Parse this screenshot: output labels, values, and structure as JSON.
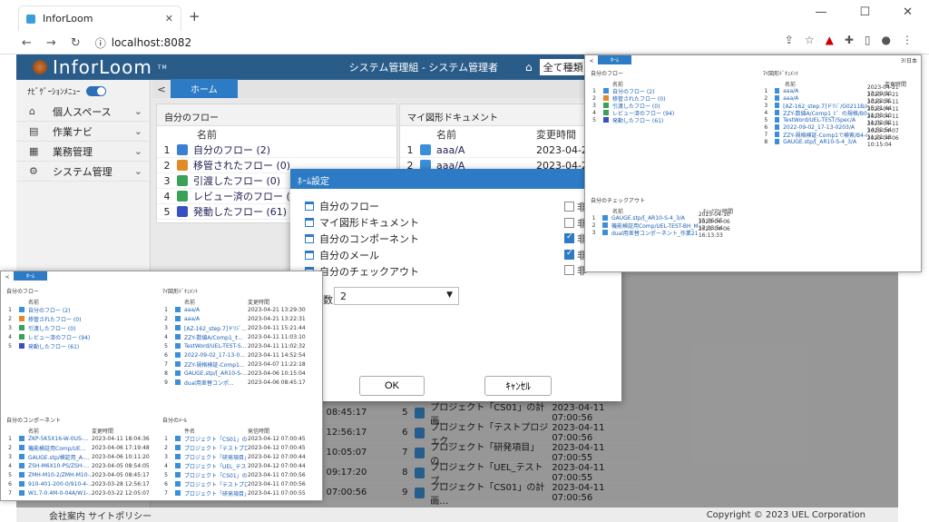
{
  "browser": {
    "tab_title": "InforLoom",
    "url": "localhost:8082",
    "new_tab": "+",
    "minimize": "—",
    "maximize": "☐",
    "close": "✕"
  },
  "app": {
    "logo": "InforLoom",
    "logo_tm": "TM",
    "company": "システム管理組 - システム管理者",
    "scope_select": "全て種類",
    "nav_menu_label": "ﾅﾋﾞｹﾞｰｼｮﾝﾒﾆｭｰ",
    "nav": [
      {
        "label": "個人スペース",
        "icon": "home-icon"
      },
      {
        "label": "作業ナビ",
        "icon": "document-icon"
      },
      {
        "label": "業務管理",
        "icon": "grid-icon"
      },
      {
        "label": "システム管理",
        "icon": "gear-icon"
      }
    ],
    "home_tab": "ホーム",
    "back": "<",
    "footer_left": "会社案内 サイトポリシー",
    "footer_right": "Copyright © 2023 UEL Corporation"
  },
  "my_flow": {
    "title": "自分のフロー",
    "col_name": "名前",
    "rows": [
      {
        "n": "1",
        "label": "自分のフロー (2)",
        "color": "#3a7fd0"
      },
      {
        "n": "2",
        "label": "移管されたフロー (0)",
        "color": "#e08a2a"
      },
      {
        "n": "3",
        "label": "引渡したフロー (0)",
        "color": "#3aa05a"
      },
      {
        "n": "4",
        "label": "レビュー済のフロー (94)",
        "color": "#3aa05a"
      },
      {
        "n": "5",
        "label": "発動したフロー (61)",
        "color": "#3a4fc0"
      }
    ]
  },
  "my_docs": {
    "title": "マイ図形ドキュメント",
    "col_name": "名前",
    "col_time": "変更時間",
    "rows": [
      {
        "n": "1",
        "label": "aaa/A",
        "time": "2023-04-2"
      },
      {
        "n": "2",
        "label": "aaa/A",
        "time": "2023-04-2"
      }
    ]
  },
  "bottom_rows": [
    {
      "n": "5",
      "left_time": "-05 08:45:17",
      "label": "プロジェクト「CS01」の計画…",
      "time": "2023-04-11 07:00:56"
    },
    {
      "n": "6",
      "left_time": "-28 12:56:17",
      "label": "プロジェクト「テストプロジェク…",
      "time": "2023-04-11 07:00:56"
    },
    {
      "n": "7",
      "left_time": "-22 10:05:07",
      "label": "プロジェクト「研発項目」の…",
      "time": "2023-04-11 07:00:55"
    },
    {
      "n": "8",
      "left_time": "-22 09:17:20",
      "label": "プロジェクト「UEL_テストプ…",
      "time": "2023-04-11 07:00:55"
    },
    {
      "n": "9",
      "left_time": "-22 07:00:56",
      "label": "プロジェクト「CS01」の計画…",
      "time": "2023-04-11 07:00:56"
    }
  ],
  "dialog": {
    "title": "ﾎｰﾑ設定",
    "options": [
      "自分のフロー",
      "マイ図形ドキュメント",
      "自分のコンポーネント",
      "自分のメール",
      "自分のチェックアウト"
    ],
    "checkbox_labels": [
      "非",
      "非",
      "非",
      "非",
      "非"
    ],
    "checked": [
      false,
      false,
      true,
      true,
      false
    ],
    "count_label": "数",
    "count_value": "2",
    "ok": "OK",
    "cancel": "ｷｬﾝｾﾙ"
  },
  "shot_right": {
    "home_tab": "ﾎｰﾑ",
    "back": "<",
    "flow_title": "自分のフロー",
    "docs_title": "ﾏｲ図形ﾄﾞｷｭﾒﾝﾄ",
    "checkout_title": "自分のチェックアウト",
    "col_name": "名前",
    "col_time": "変更時間",
    "col_checkout": "ﾁｪｯｸｱｳﾄ時間",
    "corner": "ﾖﾘ日本",
    "flows": [
      "自分のフロー (2)",
      "移管されたフロー (0)",
      "引渡したフロー (0)",
      "レビュー済のフロー (94)",
      "発動したフロー (61)"
    ],
    "docs": [
      {
        "label": "aaa/A",
        "time": "2023-04-21 13:29:30"
      },
      {
        "label": "aaa/A",
        "time": "2023-04-21 13:22:31"
      },
      {
        "label": "[AZ-162_step.7]ドﾘｼﾞ/G0211B/A",
        "time": "2023-04-11 15:21:44"
      },
      {
        "label": "ZZY-数値A/Comp1_ﾋ゛の規格/B03/A",
        "time": "2023-04-11 11:03:10"
      },
      {
        "label": "TestWord/UEL-TEST/Spec/A",
        "time": "2023-04-11 11:02:32"
      },
      {
        "label": "2022-09-02_17-13-0203/A",
        "time": "2023-04-11 14:52:54"
      },
      {
        "label": "ZZY-規格検証-Comp1で検索/B4-rel-003-A",
        "time": "2023-04-07 11:22:18"
      },
      {
        "label": "GAUGE.stp/[_AR10-S-4_3/A",
        "time": "2023-04-06 10:15:04"
      }
    ],
    "checkouts": [
      {
        "label": "GAUGE.stp/[_AR10-S-4_3/A",
        "time": "2023-04-10 15:36:55"
      },
      {
        "label": "機能検証用Comp/UEL-TEST-BH_MAX(Design)",
        "time": "2023-04-06 17:33:54"
      },
      {
        "label": "dual用差替コンポーネント_作業21hn-001-002-003(Design)",
        "time": "2023-04-06 16:13:33"
      }
    ]
  },
  "shot_left": {
    "home_tab": "ﾎｰﾑ",
    "back": "<",
    "flow_title": "自分のフロー",
    "docs_title": "ﾏｲ図形ﾄﾞｷｭﾒﾝﾄ",
    "comp_title": "自分のコンポーネント",
    "mail_title": "自分のﾒｰﾙ",
    "col_name": "名前",
    "col_time": "変更時間",
    "col_subject": "件名",
    "col_sent": "発信時間",
    "flows": [
      "自分のフロー (2)",
      "移管されたフロー (0)",
      "引渡したフロー (0)",
      "レビュー済のフロー (94)",
      "発動したフロー (61)"
    ],
    "docs": [
      {
        "label": "aaa/A",
        "time": "2023-04-21 13:29:30"
      },
      {
        "label": "aaa/A",
        "time": "2023-04-21 13:22:31"
      },
      {
        "label": "[AZ-162_step.7]ドﾘｼﾞ...",
        "time": "2023-04-11 15:21:44"
      },
      {
        "label": "ZZY-数値A/Comp1_ｵ...",
        "time": "2023-04-11 11:03:10"
      },
      {
        "label": "TestWord/UEL-TEST-S...",
        "time": "2023-04-11 11:02:32"
      },
      {
        "label": "2022-09-02_17-13-0...",
        "time": "2023-04-11 14:52:54"
      },
      {
        "label": "ZZY-規格検証-Comp1...",
        "time": "2023-04-07 11:22:18"
      },
      {
        "label": "GAUGE.stp/[_AR10-S-...",
        "time": "2023-04-06 10:15:04"
      },
      {
        "label": "dual用差替コンポ...",
        "time": "2023-04-06 08:45:17"
      }
    ],
    "comps": [
      {
        "label": "ZKP-5K5X16-W-0US-...",
        "time": "2023-04-11 18:04:36"
      },
      {
        "label": "機能検証用Comp/UE...",
        "time": "2023-04-06 17:19:48"
      },
      {
        "label": "GAUGE.stp/検証用_A-...",
        "time": "2023-04-06 10:11:20"
      },
      {
        "label": "ZSH-M6X10-PS/ZSH-...",
        "time": "2023-04-05 08:54:05"
      },
      {
        "label": "ZMH-M10-2/ZMH-M10-...",
        "time": "2023-04-05 08:45:17"
      },
      {
        "label": "910-401-200-0/910-4-...",
        "time": "2023-03-28 12:56:17"
      },
      {
        "label": "W1.7-0.4M-0-04A/W1-...",
        "time": "2023-03-22 12:05:07"
      }
    ],
    "mails": [
      {
        "label": "プロジェクト「CS01」の計画...",
        "time": "2023-04-12 07:00:45"
      },
      {
        "label": "プロジェクト「テストプロジェク...",
        "time": "2023-04-12 07:00:45"
      },
      {
        "label": "プロジェクト「研発項目」の...",
        "time": "2023-04-12 07:00:44"
      },
      {
        "label": "プロジェクト「UEL_テストプ...",
        "time": "2023-04-12 07:00:44"
      },
      {
        "label": "プロジェクト「CS01」の計画...",
        "time": "2023-04-11 07:00:56"
      },
      {
        "label": "プロジェクト「テストプロジェク...",
        "time": "2023-04-11 07:00:56"
      },
      {
        "label": "プロジェクト「研発項目」の...",
        "time": "2023-04-11 07:00:55"
      }
    ]
  }
}
